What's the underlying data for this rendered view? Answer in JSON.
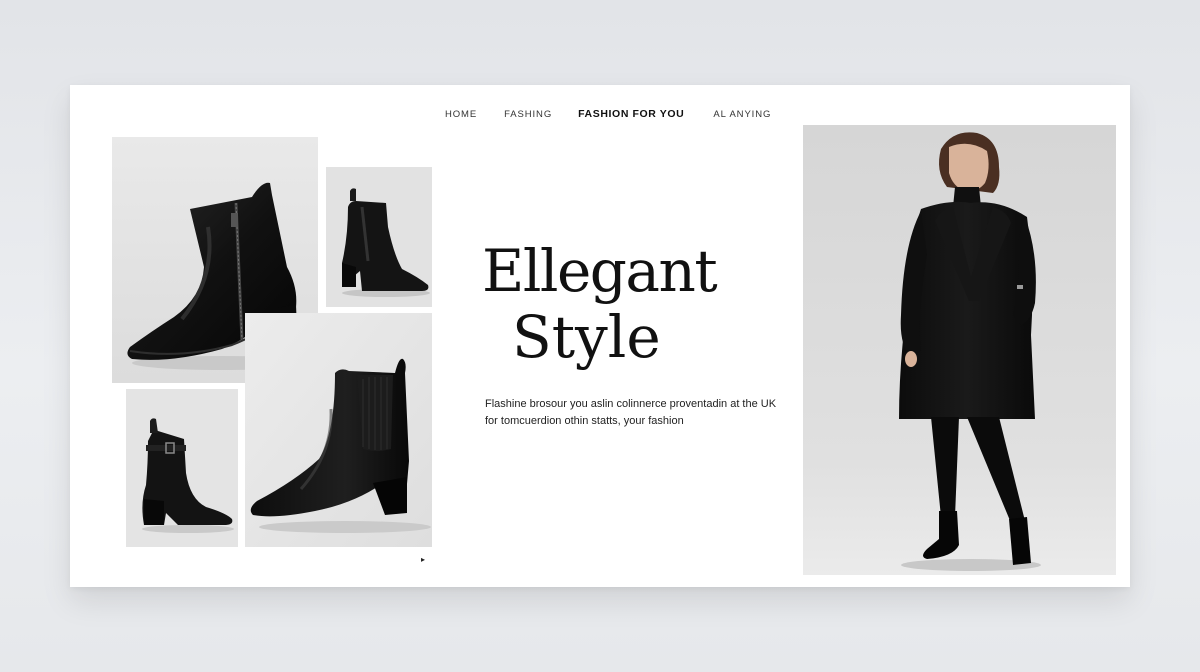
{
  "nav": {
    "items": [
      {
        "label": "HOME"
      },
      {
        "label": "FASHING"
      },
      {
        "label": "FASHION FOR YOU"
      },
      {
        "label": "AL ANYING"
      }
    ]
  },
  "hero": {
    "headline_line1": "Ellegant",
    "headline_line2": "Style",
    "description_line1": "Flashine brosour you aslin colinnerce proventadin at the UK",
    "description_line2": "for tomcuerdion othin statts, your fashion"
  },
  "gallery": {
    "tiles": [
      {
        "icon": "ankle-boot-zip"
      },
      {
        "icon": "chelsea-boot-small"
      },
      {
        "icon": "buckle-boot"
      },
      {
        "icon": "chelsea-boot-large"
      }
    ]
  },
  "model": {
    "icon": "model-black-coat"
  },
  "cursor_glyph": "▸",
  "colors": {
    "page_background": "#e6e8eb",
    "card_background": "#ffffff",
    "text_primary": "#111111",
    "tile_background": "#e4e4e4"
  }
}
